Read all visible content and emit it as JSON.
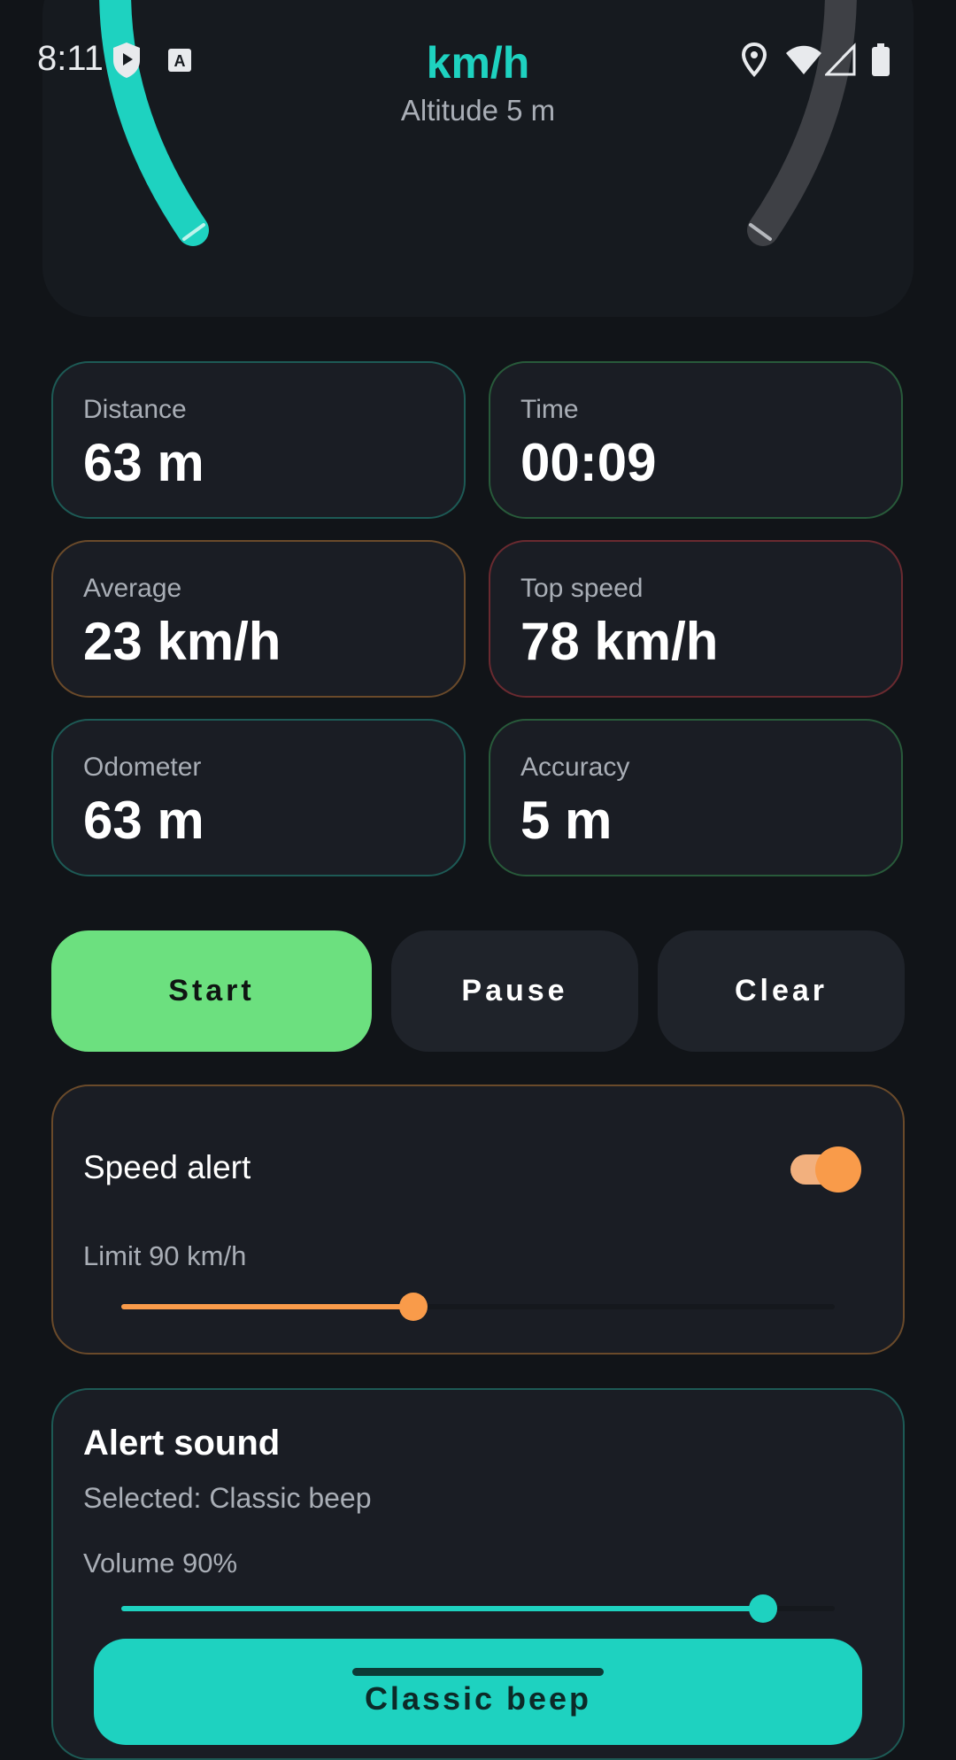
{
  "status_bar": {
    "time": "8:11"
  },
  "gauge": {
    "unit": "km/h",
    "altitude": "Altitude 5 m",
    "accent_color": "#1ed2c0"
  },
  "stats": [
    {
      "label": "Distance",
      "value": "63 m"
    },
    {
      "label": "Time",
      "value": "00:09"
    },
    {
      "label": "Average",
      "value": "23 km/h"
    },
    {
      "label": "Top speed",
      "value": "78 km/h"
    },
    {
      "label": "Odometer",
      "value": "63 m"
    },
    {
      "label": "Accuracy",
      "value": "5 m"
    }
  ],
  "controls": {
    "start": "Start",
    "pause": "Pause",
    "clear": "Clear"
  },
  "speed_alert": {
    "title": "Speed alert",
    "enabled": true,
    "limit_label": "Limit 90 km/h",
    "limit_fraction": 0.41,
    "color": "#f99b4a"
  },
  "alert_sound": {
    "title": "Alert sound",
    "selected": "Selected: Classic beep",
    "volume_label": "Volume 90%",
    "volume_fraction": 0.9,
    "button_label": "Classic beep",
    "color": "#1ed2c0"
  }
}
